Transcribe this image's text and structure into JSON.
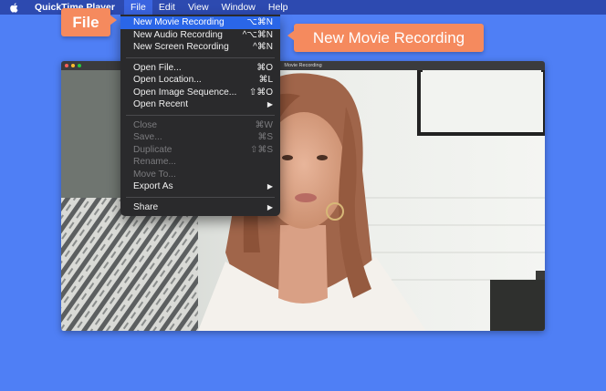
{
  "menubar": {
    "app_name": "QuickTime Player",
    "items": [
      "File",
      "Edit",
      "View",
      "Window",
      "Help"
    ]
  },
  "window": {
    "title": "Movie Recording"
  },
  "file_menu": {
    "groups": [
      [
        {
          "label": "New Movie Recording",
          "shortcut": "⌥⌘N",
          "highlighted": true
        },
        {
          "label": "New Audio Recording",
          "shortcut": "^⌥⌘N"
        },
        {
          "label": "New Screen Recording",
          "shortcut": "^⌘N"
        }
      ],
      [
        {
          "label": "Open File...",
          "shortcut": "⌘O"
        },
        {
          "label": "Open Location...",
          "shortcut": "⌘L"
        },
        {
          "label": "Open Image Sequence...",
          "shortcut": "⇧⌘O"
        },
        {
          "label": "Open Recent",
          "submenu": "▶"
        }
      ],
      [
        {
          "label": "Close",
          "shortcut": "⌘W",
          "disabled": true
        },
        {
          "label": "Save...",
          "shortcut": "⌘S",
          "disabled": true
        },
        {
          "label": "Duplicate",
          "shortcut": "⇧⌘S",
          "disabled": true
        },
        {
          "label": "Rename...",
          "disabled": true
        },
        {
          "label": "Move To...",
          "disabled": true
        },
        {
          "label": "Export As",
          "submenu": "▶"
        }
      ],
      [
        {
          "label": "Share",
          "submenu": "▶"
        }
      ]
    ]
  },
  "callouts": {
    "file": "File",
    "new_movie_recording": "New Movie Recording"
  },
  "colors": {
    "background": "#4f7ff5",
    "menubar": "#2d4ab0",
    "highlight": "#2a66e8",
    "callout": "#f58a5e"
  }
}
